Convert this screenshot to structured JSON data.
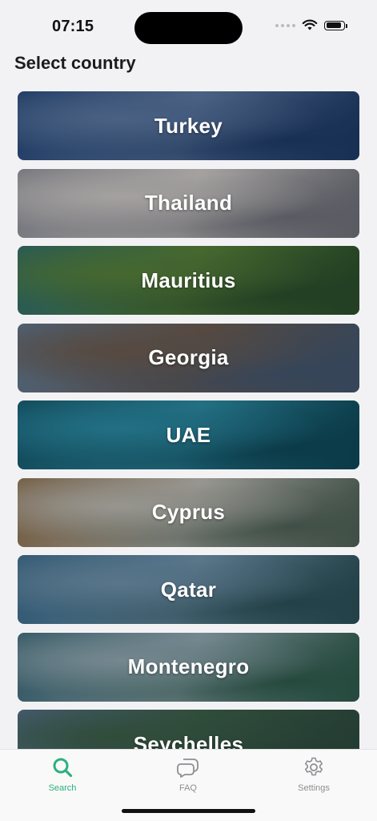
{
  "status_bar": {
    "time": "07:15",
    "battery_level": 0.9,
    "icons": [
      "signal-icon",
      "wifi-icon",
      "battery-icon"
    ]
  },
  "header": {
    "title": "Select country"
  },
  "countries": [
    {
      "name": "Turkey",
      "colors": [
        "#27497a",
        "#5b77a0",
        "#1d3a66"
      ]
    },
    {
      "name": "Thailand",
      "colors": [
        "#8c8e97",
        "#c9c5c3",
        "#6d6f78"
      ]
    },
    {
      "name": "Mauritius",
      "colors": [
        "#2f6e6b",
        "#567f3a",
        "#2b4d2c"
      ]
    },
    {
      "name": "Georgia",
      "colors": [
        "#5f7892",
        "#6a5a4f",
        "#42556d"
      ]
    },
    {
      "name": "UAE",
      "colors": [
        "#15586b",
        "#2b88a1",
        "#0e4757"
      ]
    },
    {
      "name": "Cyprus",
      "colors": [
        "#8a6f4e",
        "#b9b7b0",
        "#4e6157"
      ]
    },
    {
      "name": "Qatar",
      "colors": [
        "#3b6c8c",
        "#6d90a9",
        "#2b4f57"
      ]
    },
    {
      "name": "Montenegro",
      "colors": [
        "#3c6a78",
        "#8fa6b0",
        "#2e5a4b"
      ]
    },
    {
      "name": "Seychelles",
      "colors": [
        "#55708a",
        "#3b5e48",
        "#2d4a3f"
      ]
    }
  ],
  "tab_bar": {
    "accent_color": "#2bb07d",
    "inactive_color": "#8e8e93",
    "tabs": [
      {
        "label": "Search",
        "icon": "search-icon",
        "active": true
      },
      {
        "label": "FAQ",
        "icon": "chat-bubbles-icon",
        "active": false
      },
      {
        "label": "Settings",
        "icon": "gear-icon",
        "active": false
      }
    ]
  }
}
